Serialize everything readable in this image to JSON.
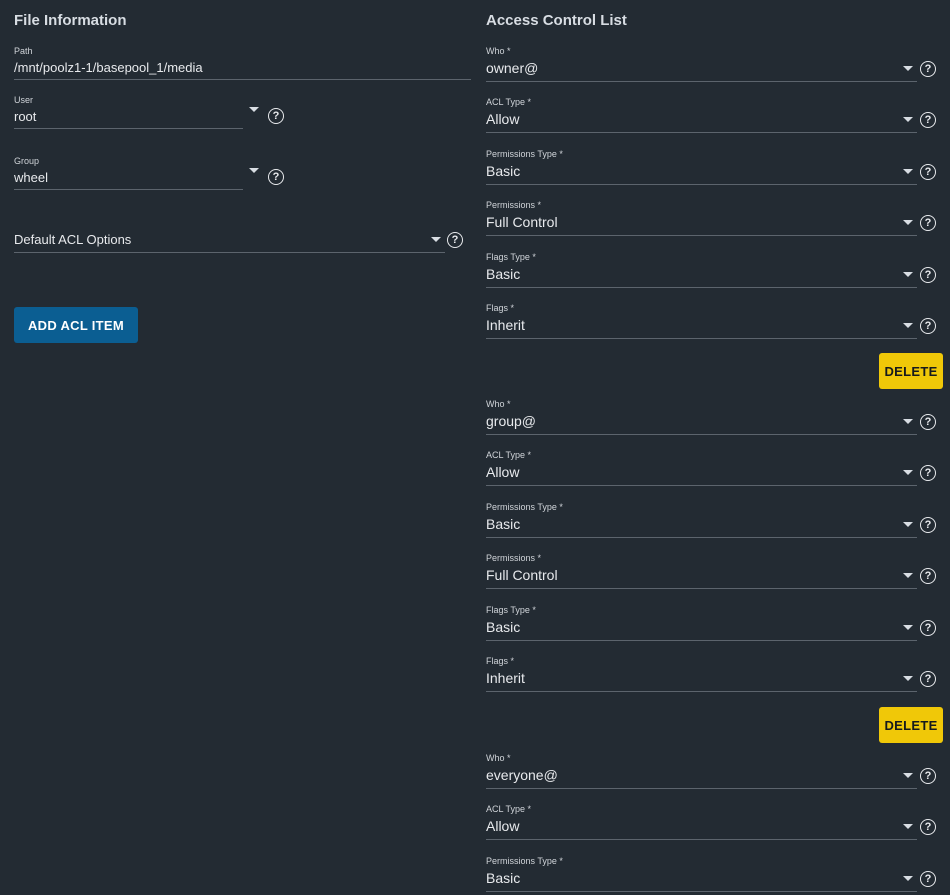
{
  "file_info": {
    "title": "File Information",
    "path": {
      "label": "Path",
      "value": "/mnt/poolz1-1/basepool_1/media"
    },
    "user": {
      "label": "User",
      "value": "root"
    },
    "group": {
      "label": "Group",
      "value": "wheel"
    },
    "default_acl": {
      "placeholder": "Default ACL Options"
    },
    "add_button": "ADD ACL ITEM"
  },
  "acl": {
    "title": "Access Control List",
    "delete_label": "DELETE",
    "help_glyph": "?",
    "entries": [
      {
        "who_label": "Who *",
        "who": "owner@",
        "acl_type_label": "ACL Type *",
        "acl_type": "Allow",
        "perm_type_label": "Permissions Type *",
        "perm_type": "Basic",
        "perm_label": "Permissions *",
        "perm": "Full Control",
        "flags_type_label": "Flags Type *",
        "flags_type": "Basic",
        "flags_label": "Flags *",
        "flags": "Inherit"
      },
      {
        "who_label": "Who *",
        "who": "group@",
        "acl_type_label": "ACL Type *",
        "acl_type": "Allow",
        "perm_type_label": "Permissions Type *",
        "perm_type": "Basic",
        "perm_label": "Permissions *",
        "perm": "Full Control",
        "flags_type_label": "Flags Type *",
        "flags_type": "Basic",
        "flags_label": "Flags *",
        "flags": "Inherit"
      },
      {
        "who_label": "Who *",
        "who": "everyone@",
        "acl_type_label": "ACL Type *",
        "acl_type": "Allow",
        "perm_type_label": "Permissions Type *",
        "perm_type": "Basic"
      }
    ]
  }
}
